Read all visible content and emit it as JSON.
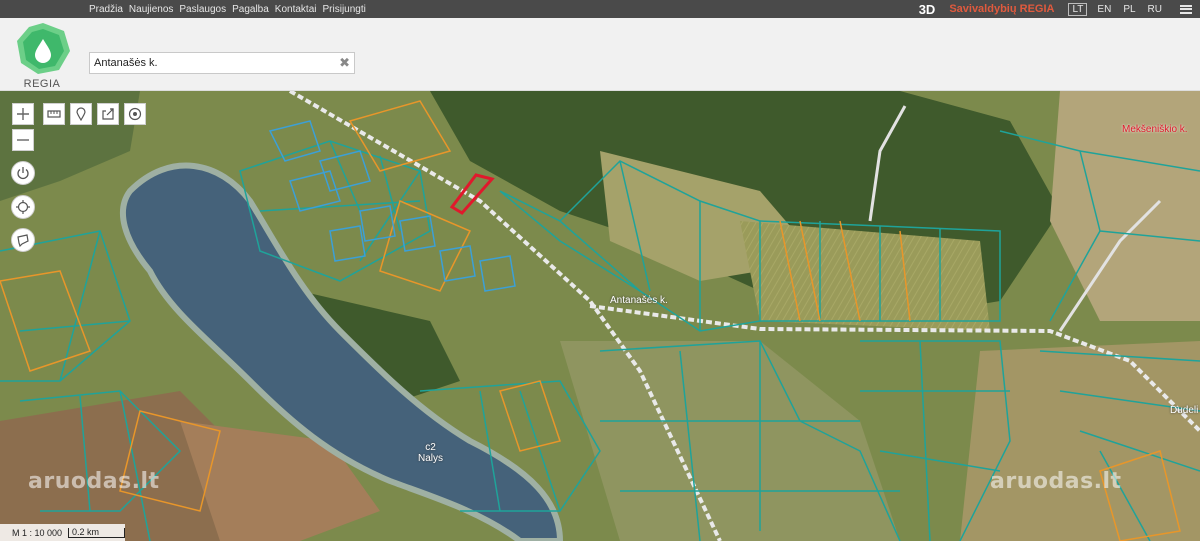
{
  "nav": {
    "items": [
      "Pradžia",
      "Naujienos",
      "Paslaugos",
      "Pagalba",
      "Kontaktai",
      "Prisijungti"
    ]
  },
  "toolbar": {
    "mode_3d": "3D",
    "brand": "Savivaldybių REGIA",
    "languages": [
      "LT",
      "EN",
      "PL",
      "RU"
    ],
    "active_language": "LT"
  },
  "logo": {
    "text": "REGIA"
  },
  "search": {
    "value": "Antanašės k."
  },
  "map": {
    "places": [
      "Antanašės k.",
      "Nalys",
      "Mekšeniškio k.",
      "Dudeli"
    ],
    "lake_code": "c2",
    "watermark": "aruodas.lt",
    "scale_ratio": "M 1 : 10 000",
    "scale_distance": "0.2 km"
  },
  "icons": {
    "zoom_in": "plus-icon",
    "zoom_out": "minus-icon",
    "measure": "ruler-icon",
    "pin": "pin-icon",
    "share": "share-icon",
    "target": "target-icon",
    "power": "power-icon",
    "crosshair": "crosshair-icon",
    "lasso": "lasso-icon",
    "clear": "close-icon"
  },
  "colors": {
    "brand_red": "#e05a3e",
    "parcel_teal": "#1fa39a",
    "parcel_orange": "#e8962a",
    "selected_parcel": "#e0192c"
  }
}
